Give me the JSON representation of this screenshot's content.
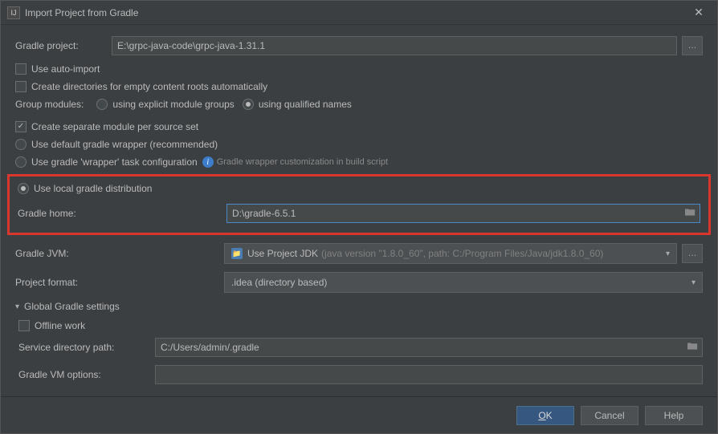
{
  "title": "Import Project from Gradle",
  "gradleProject": {
    "label": "Gradle project:",
    "value": "E:\\grpc-java-code\\grpc-java-1.31.1"
  },
  "options": {
    "autoImport": "Use auto-import",
    "createDirs": "Create directories for empty content roots automatically",
    "groupModulesLabel": "Group modules:",
    "groupExplicit": "using explicit module groups",
    "groupQualified": "using qualified names",
    "createSeparate": "Create separate module per source set",
    "useDefaultWrapper": "Use default gradle wrapper (recommended)",
    "useWrapperTask": "Use gradle 'wrapper' task configuration",
    "wrapperInfo": "Gradle wrapper customization in build script",
    "useLocal": "Use local gradle distribution"
  },
  "gradleHome": {
    "label": "Gradle home:",
    "value": "D:\\gradle-6.5.1"
  },
  "gradleJvm": {
    "label": "Gradle JVM:",
    "value": "Use Project JDK",
    "detail": "(java version \"1.8.0_60\", path: C:/Program Files/Java/jdk1.8.0_60)"
  },
  "projectFormat": {
    "label": "Project format:",
    "value": ".idea (directory based)"
  },
  "global": {
    "header": "Global Gradle settings",
    "offline": "Offline work",
    "serviceDirLabel": "Service directory path:",
    "serviceDirValue": "C:/Users/admin/.gradle",
    "vmOptionsLabel": "Gradle VM options:",
    "vmOptionsValue": ""
  },
  "buttons": {
    "ok": "OK",
    "cancel": "Cancel",
    "help": "Help"
  }
}
